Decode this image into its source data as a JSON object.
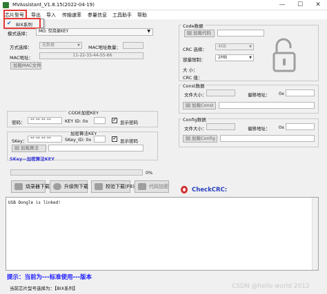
{
  "window": {
    "title": "MVAssistant_V1.8.15(2022-04-19)",
    "minimize": "—",
    "maximize": "☐",
    "close": "✕"
  },
  "menu": [
    "芯片型号",
    "导出",
    "导入",
    "传输速率",
    "参量信息",
    "工具助手",
    "帮助"
  ],
  "chip_dropdown": {
    "checked": true,
    "check_glyph": "✔",
    "label": "BIX系列"
  },
  "left": {
    "mode_label": "模式选择：",
    "mode_value": "MO: 仅烧录KEY",
    "scheme_label": "方式选择：",
    "scheme_value": "无数据",
    "mac_count_label": "MAC地址数量：",
    "mac_label": "MAC地址：",
    "mac_value": "11-22-33-44-55-66",
    "load_mac_btn": "加载MAC文件",
    "code_key_title": "CODE加密KEY",
    "password_label": "密码：",
    "password_value": "** ** ** **",
    "key_id_label": "KEY ID: 0x",
    "show_password_label": "显示密码",
    "algo_title": "加密算法KEY",
    "skey_label": "SKey：",
    "skey_value": "** ** ** **",
    "skey_id_label": "SKey_ID: 0x",
    "load_algo_btn": "加载算法",
    "skey_note": "SKey—加密算法KEY",
    "progress_text": "0%",
    "progress_value": 0
  },
  "buttons": {
    "burn": "烧录器下载",
    "upgrade": "升级狗下载",
    "verify": "校验下载(F8)",
    "code_encrypt": "代码加密"
  },
  "right": {
    "code_data_title": "Code数据",
    "load_code_btn": "加载代码",
    "crc_select_label": "CRC 选择：",
    "crc_select_value": "4KB",
    "capacity_label": "容量限制：",
    "capacity_value": "2MB",
    "size_label": "大 小：",
    "crc_value_label": "CRC 值：",
    "const_title": "Const数据",
    "file_size_label": "文件大小：",
    "offset_label": "偏移地址：",
    "offset_prefix": "0x",
    "load_const_btn": "加载Const",
    "config_title": "Config数据",
    "load_config_btn": "加载Config",
    "checkcrc_label": "CheckCRC:"
  },
  "log": {
    "text": "USB Dongle is linked!"
  },
  "status": {
    "hint": "提示：当前为---标准使用---版本",
    "current_chip": "当前芯片型号选择为：【BIX系列】",
    "watermark": "CSDN @hello world 2012"
  },
  "colors": {
    "highlight": "#e53935",
    "hint_blue": "#1a1aff",
    "checkcrc_red": "#d32f2f",
    "lock_gray": "#9e9e9e"
  },
  "icons": {
    "lock": "unlocked-padlock-icon",
    "crc": "red-circle-icon",
    "check": "checkmark-icon"
  }
}
